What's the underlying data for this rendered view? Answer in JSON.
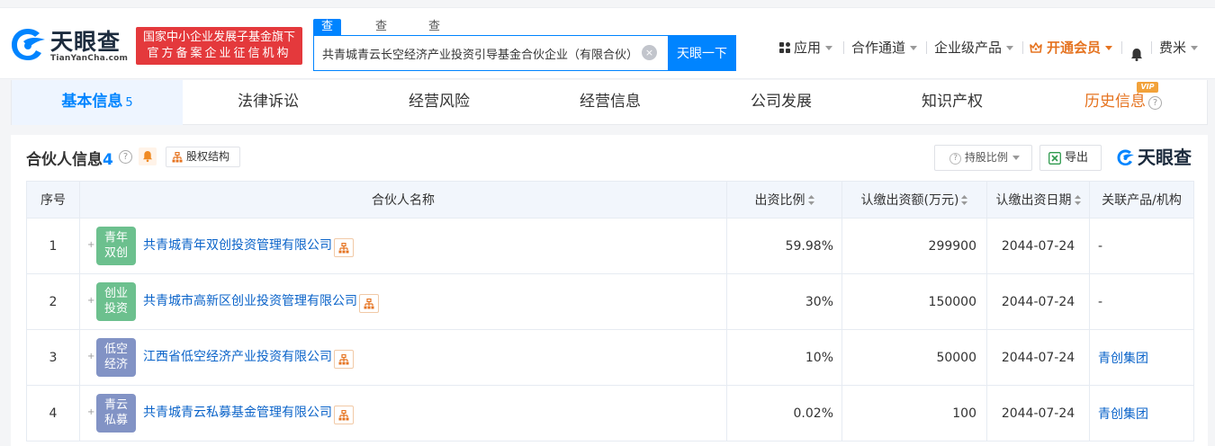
{
  "header": {
    "logo_cn": "天眼查",
    "logo_en": "TianYanCha.com",
    "badge_line1": "国家中小企业发展子基金旗下",
    "badge_line2": "官方备案企业征信机构",
    "search_tabs": [
      "查公司",
      "查老板",
      "查关系"
    ],
    "search_value": "共青城青云长空经济产业投资引导基金合伙企业（有限合伙）",
    "clear_glyph": "×",
    "search_button": "天眼一下",
    "nav": {
      "apps": "应用",
      "partner": "合作通道",
      "enterprise": "企业级产品",
      "vip": "开通会员",
      "user": "费米"
    }
  },
  "tabs": [
    {
      "label": "基本信息",
      "count": "5"
    },
    {
      "label": "法律诉讼"
    },
    {
      "label": "经营风险"
    },
    {
      "label": "经营信息"
    },
    {
      "label": "公司发展"
    },
    {
      "label": "知识产权"
    },
    {
      "label": "历史信息",
      "tag": "VIP"
    }
  ],
  "section": {
    "title": "合伙人信息",
    "count": "4",
    "equity_button": "股权结构",
    "ratio_button": "持股比例",
    "export_button": "导出",
    "watermark": "天眼查"
  },
  "table": {
    "headers": {
      "index": "序号",
      "name": "合伙人名称",
      "ratio": "出资比例",
      "amount": "认缴出资额(万元)",
      "date": "认缴出资日期",
      "related": "关联产品/机构"
    },
    "rows": [
      {
        "index": "1",
        "avatar": [
          "青年",
          "双创"
        ],
        "avatar_color": "#6cc08e",
        "name": "共青城青年双创投资管理有限公司",
        "ratio": "59.98%",
        "amount": "299900",
        "date": "2044-07-24",
        "related": "-"
      },
      {
        "index": "2",
        "avatar": [
          "创业",
          "投资"
        ],
        "avatar_color": "#6cc08e",
        "name": "共青城市高新区创业投资管理有限公司",
        "ratio": "30%",
        "amount": "150000",
        "date": "2044-07-24",
        "related": "-"
      },
      {
        "index": "3",
        "avatar": [
          "低空",
          "经济"
        ],
        "avatar_color": "#8293c5",
        "name": "江西省低空经济产业投资有限公司",
        "ratio": "10%",
        "amount": "50000",
        "date": "2044-07-24",
        "related": "青创集团"
      },
      {
        "index": "4",
        "avatar": [
          "青云",
          "私募"
        ],
        "avatar_color": "#8293c5",
        "name": "共青城青云私募基金管理有限公司",
        "ratio": "0.02%",
        "amount": "100",
        "date": "2044-07-24",
        "related": "青创集团"
      }
    ]
  },
  "colors": {
    "brand_blue": "#0084ff",
    "link_blue": "#0a63c9",
    "badge_red": "#e4393c",
    "vip_orange": "#e57320"
  }
}
